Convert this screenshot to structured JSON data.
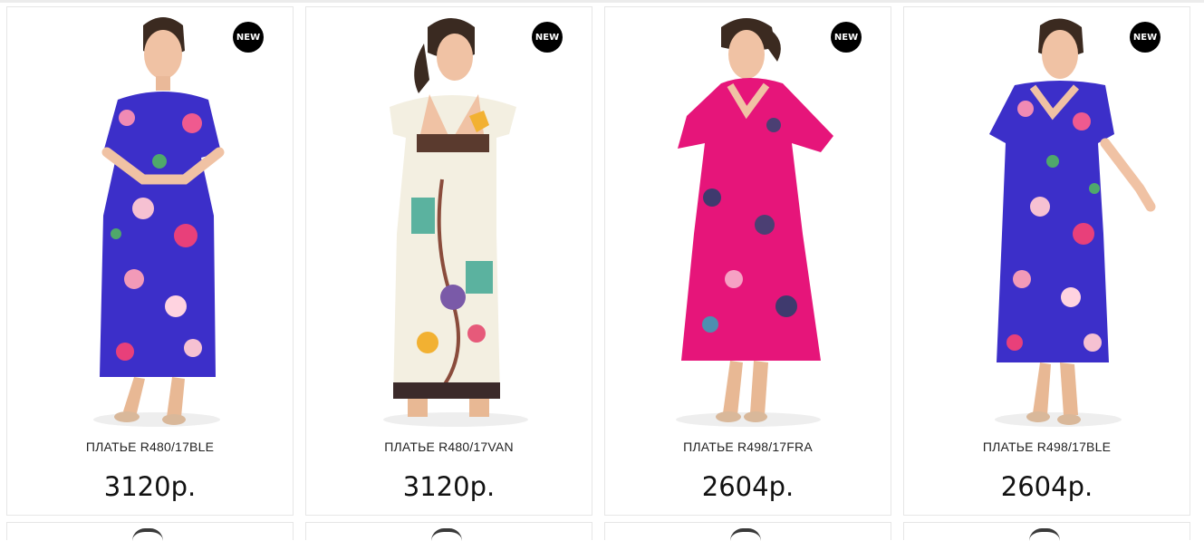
{
  "products": [
    {
      "name": "ПЛАТЬЕ R480/17BLE",
      "price": "3120р.",
      "badge": "NEW",
      "dress_color": "#3c2fc9",
      "print": "floral"
    },
    {
      "name": "ПЛАТЬЕ R480/17VAN",
      "price": "3120р.",
      "badge": "NEW",
      "dress_color": "#f3efe1",
      "print": "ornamental"
    },
    {
      "name": "ПЛАТЬЕ R498/17FRA",
      "price": "2604р.",
      "badge": "NEW",
      "dress_color": "#e6157a",
      "print": "floral"
    },
    {
      "name": "ПЛАТЬЕ R498/17BLE",
      "price": "2604р.",
      "badge": "NEW",
      "dress_color": "#3c2fc9",
      "print": "floral"
    }
  ]
}
